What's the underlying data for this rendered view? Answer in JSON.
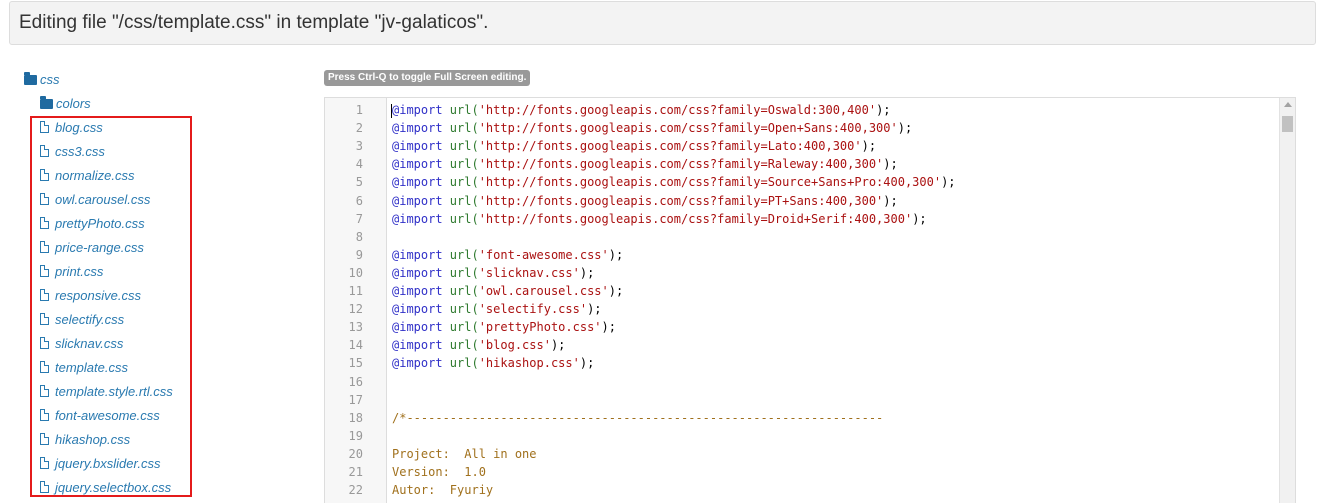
{
  "header": {
    "title": "Editing file \"/css/template.css\" in template \"jv-galaticos\"."
  },
  "tree": {
    "root_folder": "css",
    "sub_folder": "colors",
    "files": [
      "blog.css",
      "css3.css",
      "normalize.css",
      "owl.carousel.css",
      "prettyPhoto.css",
      "price-range.css",
      "print.css",
      "responsive.css",
      "selectify.css",
      "slicknav.css",
      "template.css",
      "template.style.rtl.css",
      "font-awesome.css",
      "hikashop.css",
      "jquery.bxslider.css",
      "jquery.selectbox.css"
    ]
  },
  "editor": {
    "hint": "Press Ctrl-Q to toggle Full Screen editing.",
    "lines": [
      {
        "n": "1",
        "kw": "@import",
        "fn": " url(",
        "str": "'http://fonts.googleapis.com/css?family=Oswald:300,400'",
        "tail": ");"
      },
      {
        "n": "2",
        "kw": "@import",
        "fn": " url(",
        "str": "'http://fonts.googleapis.com/css?family=Open+Sans:400,300'",
        "tail": ");"
      },
      {
        "n": "3",
        "kw": "@import",
        "fn": " url(",
        "str": "'http://fonts.googleapis.com/css?family=Lato:400,300'",
        "tail": ");"
      },
      {
        "n": "4",
        "kw": "@import",
        "fn": " url(",
        "str": "'http://fonts.googleapis.com/css?family=Raleway:400,300'",
        "tail": ");"
      },
      {
        "n": "5",
        "kw": "@import",
        "fn": " url(",
        "str": "'http://fonts.googleapis.com/css?family=Source+Sans+Pro:400,300'",
        "tail": ");"
      },
      {
        "n": "6",
        "kw": "@import",
        "fn": " url(",
        "str": "'http://fonts.googleapis.com/css?family=PT+Sans:400,300'",
        "tail": ");"
      },
      {
        "n": "7",
        "kw": "@import",
        "fn": " url(",
        "str": "'http://fonts.googleapis.com/css?family=Droid+Serif:400,300'",
        "tail": ");"
      },
      {
        "n": "8",
        "kw": "",
        "fn": "",
        "str": "",
        "tail": ""
      },
      {
        "n": "9",
        "kw": "@import",
        "fn": " url(",
        "str": "'font-awesome.css'",
        "tail": ");"
      },
      {
        "n": "10",
        "kw": "@import",
        "fn": " url(",
        "str": "'slicknav.css'",
        "tail": ");"
      },
      {
        "n": "11",
        "kw": "@import",
        "fn": " url(",
        "str": "'owl.carousel.css'",
        "tail": ");"
      },
      {
        "n": "12",
        "kw": "@import",
        "fn": " url(",
        "str": "'selectify.css'",
        "tail": ");"
      },
      {
        "n": "13",
        "kw": "@import",
        "fn": " url(",
        "str": "'prettyPhoto.css'",
        "tail": ");"
      },
      {
        "n": "14",
        "kw": "@import",
        "fn": " url(",
        "str": "'blog.css'",
        "tail": ");"
      },
      {
        "n": "15",
        "kw": "@import",
        "fn": " url(",
        "str": "'hikashop.css'",
        "tail": ");"
      },
      {
        "n": "16",
        "comment": ""
      },
      {
        "n": "17",
        "comment": ""
      },
      {
        "n": "18",
        "comment": "/*------------------------------------------------------------------"
      },
      {
        "n": "19",
        "comment": ""
      },
      {
        "n": "20",
        "comment": "Project:  All in one"
      },
      {
        "n": "21",
        "comment": "Version:  1.0"
      },
      {
        "n": "22",
        "comment": "Autor:  Fyuriy"
      }
    ]
  }
}
